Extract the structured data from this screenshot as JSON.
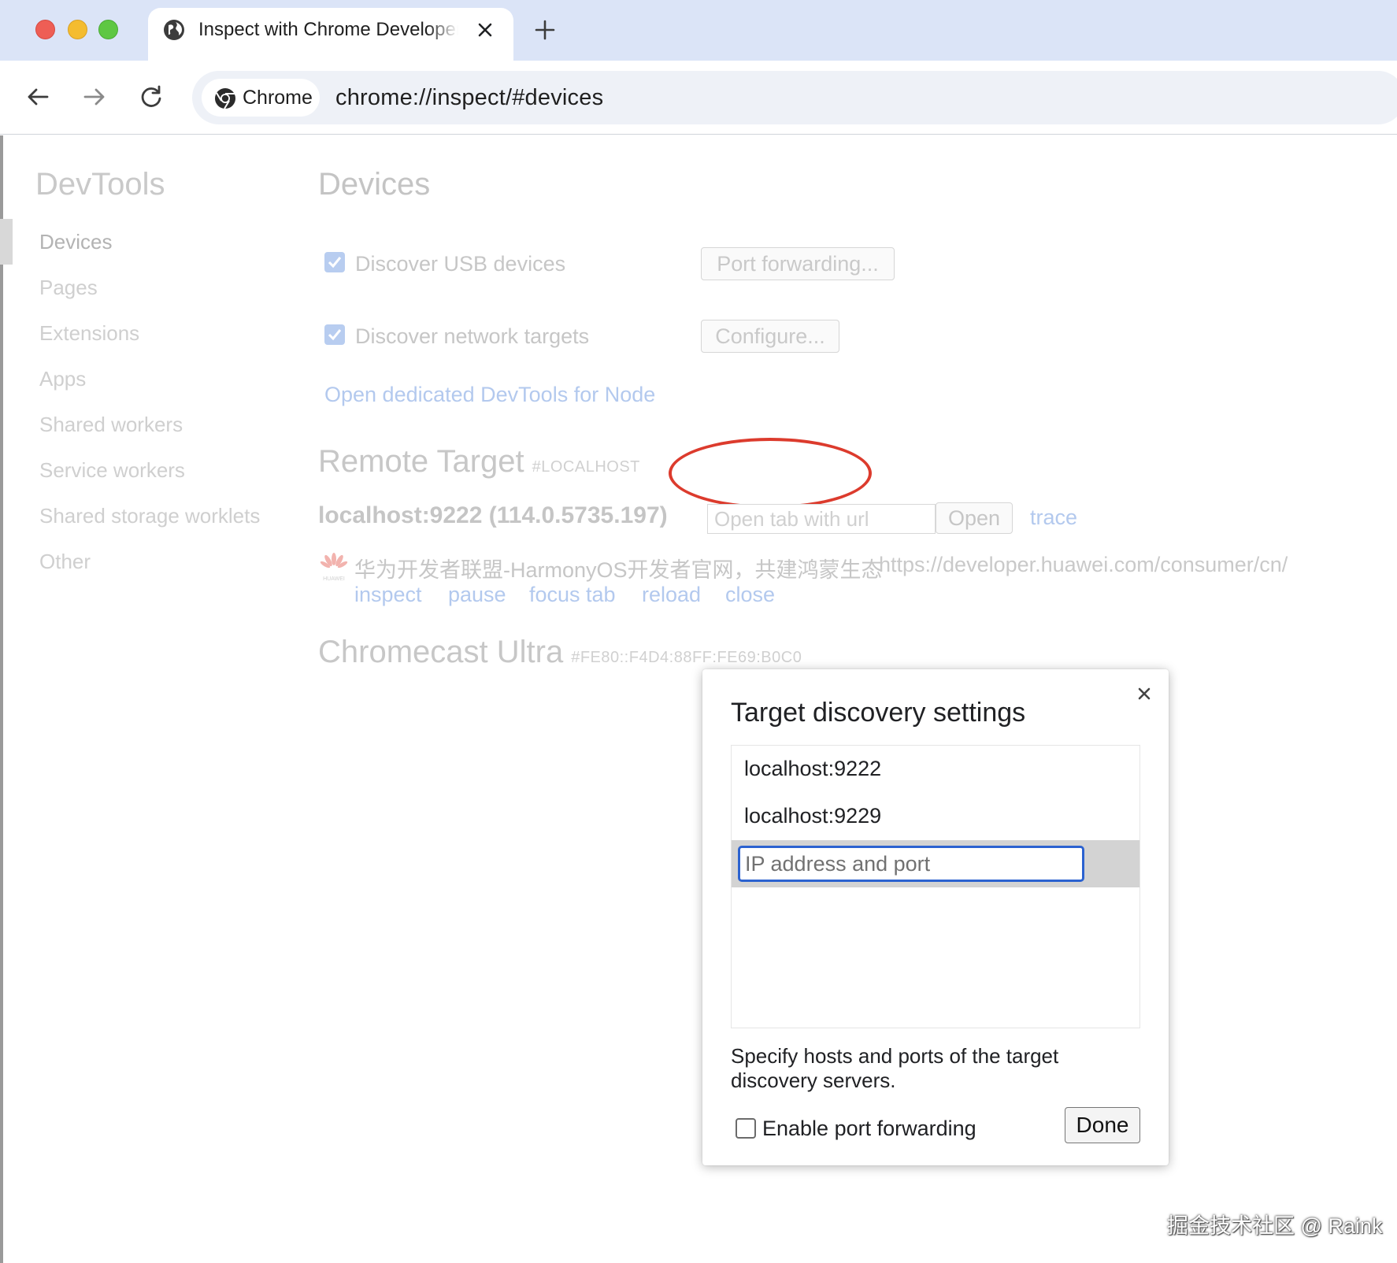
{
  "browser": {
    "tab_title": "Inspect with Chrome Developer Tools",
    "chip_label": "Chrome",
    "url": "chrome://inspect/#devices"
  },
  "sidebar": {
    "title": "DevTools",
    "items": [
      {
        "label": "Devices"
      },
      {
        "label": "Pages"
      },
      {
        "label": "Extensions"
      },
      {
        "label": "Apps"
      },
      {
        "label": "Shared workers"
      },
      {
        "label": "Service workers"
      },
      {
        "label": "Shared storage worklets"
      },
      {
        "label": "Other"
      }
    ]
  },
  "devices": {
    "title": "Devices",
    "usb_label": "Discover USB devices",
    "usb_checked": true,
    "port_forwarding_button": "Port forwarding...",
    "network_label": "Discover network targets",
    "network_checked": true,
    "configure_button": "Configure...",
    "node_link": "Open dedicated DevTools for Node",
    "remote": {
      "title": "Remote Target",
      "subtitle": "#LOCALHOST",
      "host": "localhost:9222 (114.0.5735.197)",
      "open_tab_placeholder": "Open tab with url",
      "open_button": "Open",
      "trace_link": "trace",
      "page_title": "华为开发者联盟-HarmonyOS开发者官网，共建鸿蒙生态",
      "page_url": "https://developer.huawei.com/consumer/cn/",
      "page_logo_text": "HUAWEI",
      "actions": [
        "inspect",
        "pause",
        "focus tab",
        "reload",
        "close"
      ]
    },
    "chromecast": {
      "title": "Chromecast Ultra",
      "subtitle": "#FE80::F4D4:88FF:FE69:B0C0"
    }
  },
  "dialog": {
    "title": "Target discovery settings",
    "entries": [
      "localhost:9222",
      "localhost:9229"
    ],
    "input_placeholder": "IP address and port",
    "input_value": "",
    "description": "Specify hosts and ports of the target discovery servers.",
    "enable_label": "Enable port forwarding",
    "enable_checked": false,
    "done_button": "Done"
  },
  "watermark": "掘金技术社区 @ Raink",
  "colors": {
    "tabstrip": "#dbe4f7",
    "annotation": "#dc3b2d",
    "focus_ring": "#2b62d0",
    "link_dimmed": "#b3c9ee"
  }
}
